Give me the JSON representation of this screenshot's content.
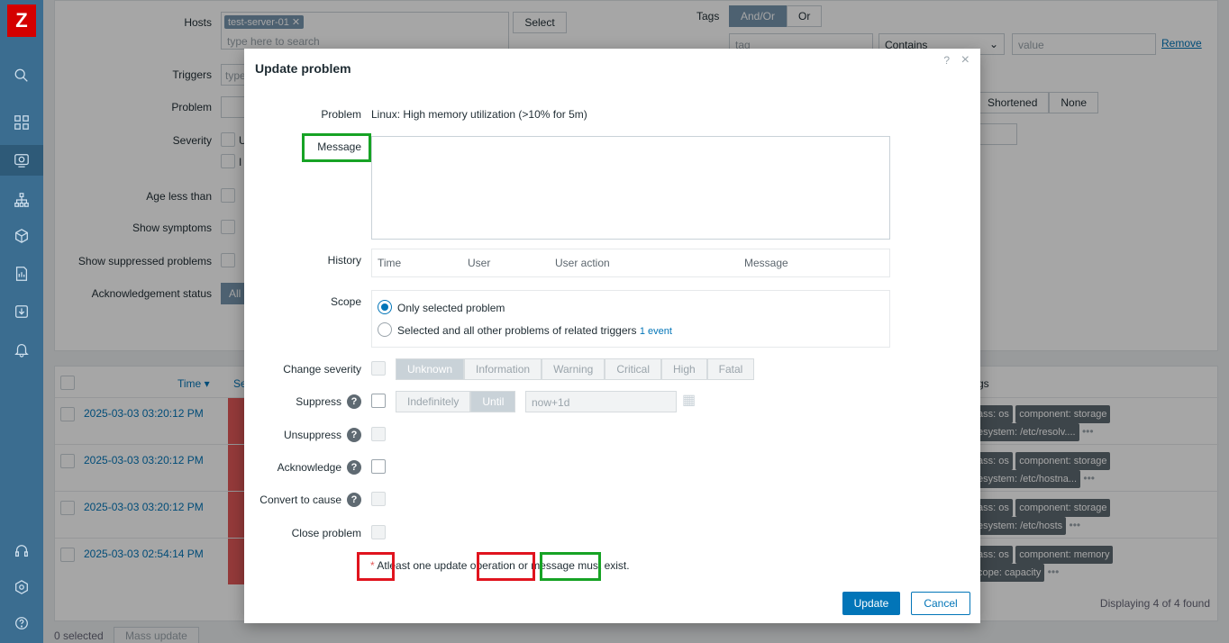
{
  "app": {
    "logo": "Z"
  },
  "sidebar": {
    "icons": [
      "search-icon",
      "dashboard-icon",
      "monitoring-icon",
      "network-icon",
      "inventory-icon",
      "reports-icon",
      "data-collection-icon",
      "alerts-icon",
      "support-icon",
      "integrations-icon",
      "help-icon"
    ]
  },
  "filter": {
    "hosts_label": "Hosts",
    "host_chip": "test-server-01",
    "hosts_placeholder": "type here to search",
    "select_btn": "Select",
    "tags_label": "Tags",
    "tags_andor": "And/Or",
    "tags_or": "Or",
    "tag_placeholder": "tag",
    "tag_operator": "Contains",
    "value_placeholder": "value",
    "remove_link": "Remove",
    "triggers_label": "Triggers",
    "triggers_placeholder": "type",
    "problem_label": "Problem",
    "severity_label": "Severity",
    "severity_partial_1": "U",
    "severity_partial_2": "I",
    "age_label": "Age less than",
    "symptoms_label": "Show symptoms",
    "suppressed_label": "Show suppressed problems",
    "ack_label": "Acknowledgement status",
    "ack_value": "All",
    "tag_display_shortened": "Shortened",
    "tag_display_none": "None"
  },
  "table": {
    "col_time": "Time",
    "col_sev_partial": "Se",
    "col_tags_partial": "gs",
    "rows": [
      {
        "time": "2025-03-03 03:20:12 PM",
        "tag1": "ass: os",
        "tag2": "component: storage",
        "tag3": "esystem: /etc/resolv...."
      },
      {
        "time": "2025-03-03 03:20:12 PM",
        "tag1": "ass: os",
        "tag2": "component: storage",
        "tag3": "esystem: /etc/hostna..."
      },
      {
        "time": "2025-03-03 03:20:12 PM",
        "tag1": "ass: os",
        "tag2": "component: storage",
        "tag3": "esystem: /etc/hosts"
      },
      {
        "time": "2025-03-03 02:54:14 PM",
        "tag1": "ass: os",
        "tag2": "component: memory",
        "tag3": "cope: capacity"
      }
    ],
    "displaying": "Displaying 4 of 4 found"
  },
  "footer": {
    "selected": "0 selected",
    "mass_update": "Mass update"
  },
  "dialog": {
    "title": "Update problem",
    "help": "?",
    "close": "×",
    "problem_label": "Problem",
    "problem_value": "Linux: High memory utilization (>10% for 5m)",
    "message_label": "Message",
    "history_label": "History",
    "history_cols": {
      "time": "Time",
      "user": "User",
      "action": "User action",
      "message": "Message"
    },
    "scope_label": "Scope",
    "scope_opt1": "Only selected problem",
    "scope_opt2": "Selected and all other problems of related triggers",
    "scope_events": "1 event",
    "change_severity_label": "Change severity",
    "severities": [
      "Unknown",
      "Information",
      "Warning",
      "Critical",
      "High",
      "Fatal"
    ],
    "suppress_label": "Suppress",
    "suppress_indef": "Indefinitely",
    "suppress_until": "Until",
    "suppress_value": "now+1d",
    "unsuppress_label": "Unsuppress",
    "acknowledge_label": "Acknowledge",
    "convert_label": "Convert to cause",
    "close_label": "Close problem",
    "note_star": "*",
    "note_1": "At",
    "note_2": "least one update",
    "note_op": "operation",
    "note_or": "or",
    "note_msg": "message",
    "note_3": "must exist.",
    "update_btn": "Update",
    "cancel_btn": "Cancel"
  }
}
